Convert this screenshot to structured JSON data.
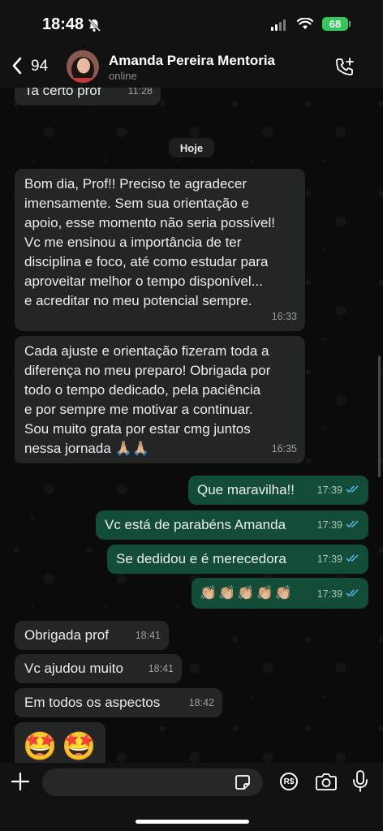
{
  "status_bar": {
    "time": "18:48",
    "battery": "68"
  },
  "header": {
    "back_count": "94",
    "contact_name": "Amanda Pereira Mentoria",
    "contact_status": "online"
  },
  "chat": {
    "date_separator": "Hoje",
    "messages": [
      {
        "dir": "in",
        "text": "Ta certo prof",
        "time": "11:28"
      },
      {
        "dir": "in",
        "text": "Bom dia, Prof!! Preciso te agradecer\nimensamente. Sem sua orientação e\napoio, esse momento não seria possível!\nVc me ensinou a importância de ter\ndisciplina e foco, até como estudar para\naproveitar melhor o tempo disponível...\ne acreditar no meu potencial sempre.",
        "time": "16:33"
      },
      {
        "dir": "in",
        "text": "Cada ajuste e orientação fizeram toda a\ndiferença no meu preparo! Obrigada por\ntodo o tempo dedicado, pela paciência\ne por sempre me motivar a continuar.\nSou muito grata por estar cmg juntos\nnessa jornada 🙏🏼🙏🏼",
        "time": "16:35"
      },
      {
        "dir": "out",
        "text": "Que maravilha!!",
        "time": "17:39"
      },
      {
        "dir": "out",
        "text": "Vc está de parabéns Amanda",
        "time": "17:39"
      },
      {
        "dir": "out",
        "text": "Se dedidou e é merecedora",
        "time": "17:39"
      },
      {
        "dir": "out",
        "text": "👏🏼👏🏼👏🏼👏🏼👏🏼",
        "time": "17:39"
      },
      {
        "dir": "in",
        "text": "Obrigada prof",
        "time": "18:41"
      },
      {
        "dir": "in",
        "text": "Vc ajudou muito",
        "time": "18:41"
      },
      {
        "dir": "in",
        "text": "Em todos os aspectos",
        "time": "18:42"
      },
      {
        "dir": "in",
        "text": "🤩🤩",
        "time": ""
      }
    ]
  },
  "input_bar": {
    "placeholder": ""
  },
  "colors": {
    "incoming_bubble": "#242626",
    "outgoing_bubble": "#144d37",
    "read_ticks": "#53bdeb",
    "battery": "#34c759"
  },
  "icons": [
    "bell-slash-icon",
    "signal-icon",
    "wifi-icon",
    "battery-icon",
    "chevron-left-icon",
    "add-call-icon",
    "plus-icon",
    "sticker-icon",
    "rs-icon",
    "camera-icon",
    "microphone-icon"
  ]
}
